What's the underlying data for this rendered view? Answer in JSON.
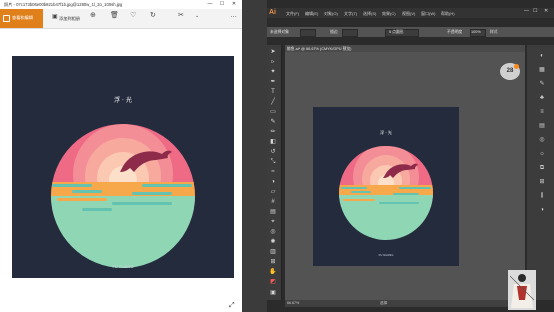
{
  "photos": {
    "window_title": "照片 - 07c173b06e00b821b47f1b.jpg@1280w_1l_2o_100sh.jpg",
    "toolbar": {
      "edit_label": "查看和编辑",
      "add_label": "添加到相册",
      "text_lines": [
        "P",
        "添加到相册"
      ],
      "icons": [
        "zoom-icon",
        "delete-icon",
        "favorite-icon",
        "rotate-icon",
        "edit-tools-icon",
        "more-icon"
      ]
    },
    "poster": {
      "title": "浮 · 光",
      "caption": "FU GUANG"
    }
  },
  "illustrator": {
    "app_short": "Ai",
    "menus": [
      "文件(F)",
      "编辑(E)",
      "对象(O)",
      "文字(T)",
      "选择(S)",
      "效果(C)",
      "视图(V)",
      "窗口(W)",
      "帮助(H)"
    ],
    "control_bar": {
      "label": "未选择对象",
      "stroke": "描边",
      "style": "5 点圆形",
      "opacity_label": "不透明度",
      "opacity_value": "100%",
      "style_label": "样式"
    },
    "document_tab": "鲸鱼.ai* @ 66.67% (CMYK/GPU 预览)",
    "zoom_status": "66.67%",
    "status_text": "选择",
    "badge_text": "28",
    "poster": {
      "title": "浮 · 光",
      "caption": "FU GUANG"
    }
  },
  "colors": {
    "navy": "#232b3d",
    "pink": "#ee6a85",
    "peach": "#f8a99e",
    "sun": "#f7a84a",
    "sea": "#8fd6b5",
    "sea_dark": "#63c2b0",
    "dolphin": "#8e2b4a",
    "edit_button": "#e0801b"
  }
}
